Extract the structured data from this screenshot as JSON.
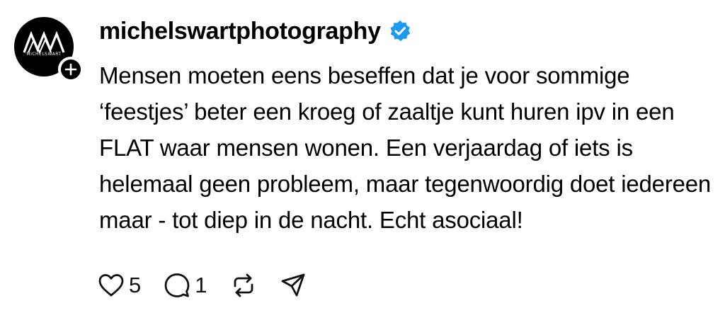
{
  "post": {
    "username": "michelswartphotography",
    "verified": true,
    "avatar_logo_text": "MICHELSWART",
    "text": "Mensen moeten eens beseffen dat je voor sommige ‘feestjes’ beter een kroeg of zaaltje kunt huren ipv in een FLAT waar mensen wonen. Een verjaardag of iets is helemaal geen probleem, maar tegenwoordig doet iedereen maar - tot diep in de nacht. Echt asociaal!",
    "likes": "5",
    "replies": "1"
  },
  "icons": {
    "follow": "plus-icon",
    "verified": "verified-badge-icon",
    "like": "heart-icon",
    "reply": "comment-icon",
    "repost": "repost-icon",
    "share": "send-icon"
  },
  "colors": {
    "verified_blue": "#1d9bf0",
    "text": "#000000",
    "background": "#ffffff"
  }
}
